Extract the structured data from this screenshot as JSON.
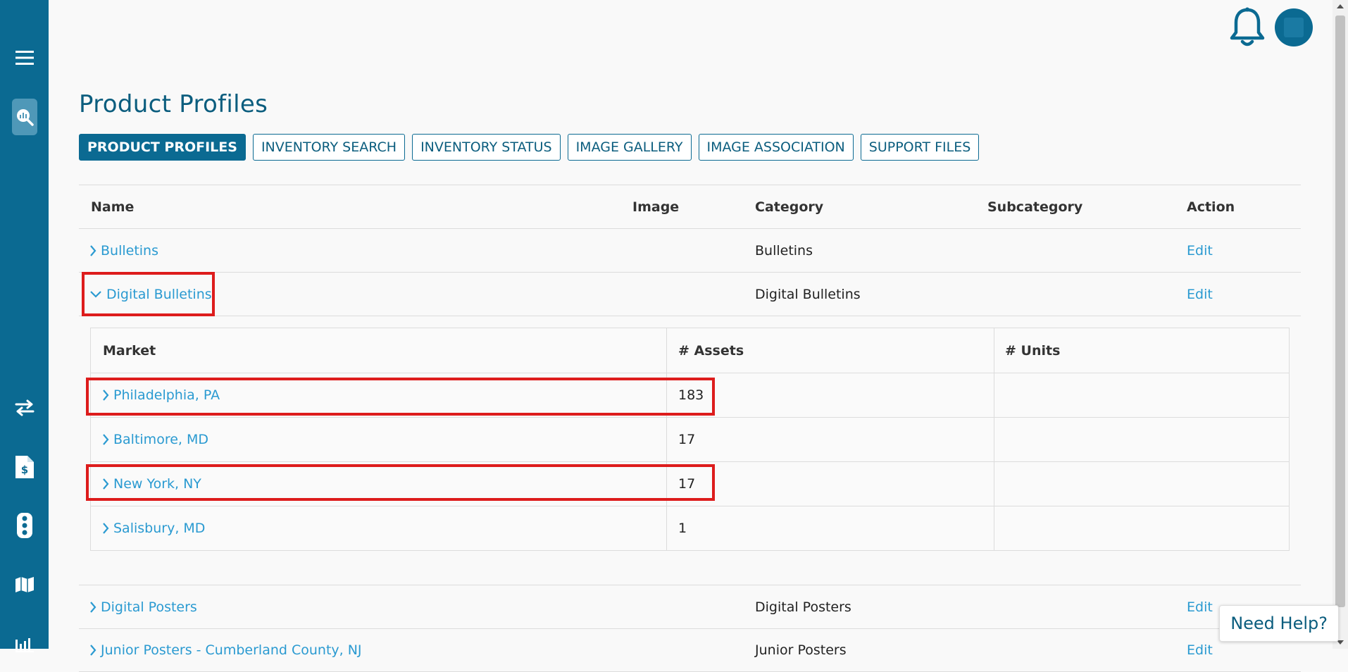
{
  "sidebar": {
    "icons": [
      "menu-icon",
      "inventory-search-icon",
      "swap-icon",
      "invoice-icon",
      "traffic-light-icon",
      "map-icon",
      "bar-chart-icon"
    ]
  },
  "header": {
    "bell_icon": "bell-icon",
    "avatar_icon": "avatar"
  },
  "page": {
    "title": "Product Profiles",
    "tabs": [
      {
        "label": "PRODUCT PROFILES",
        "active": true
      },
      {
        "label": "INVENTORY SEARCH",
        "active": false
      },
      {
        "label": "INVENTORY STATUS",
        "active": false
      },
      {
        "label": "IMAGE GALLERY",
        "active": false
      },
      {
        "label": "IMAGE ASSOCIATION",
        "active": false
      },
      {
        "label": "SUPPORT FILES",
        "active": false
      }
    ]
  },
  "table": {
    "headers": {
      "name": "Name",
      "image": "Image",
      "category": "Category",
      "subcategory": "Subcategory",
      "action": "Action"
    },
    "rows": [
      {
        "name": "Bulletins",
        "category": "Bulletins",
        "action": "Edit",
        "expanded": false
      },
      {
        "name": "Digital Bulletins",
        "category": "Digital Bulletins",
        "action": "Edit",
        "expanded": true
      },
      {
        "name": "Digital Posters",
        "category": "Digital Posters",
        "action": "Edit",
        "expanded": false
      },
      {
        "name": "Junior Posters - Cumberland County, NJ",
        "category": "Junior Posters",
        "action": "Edit",
        "expanded": false
      }
    ]
  },
  "subtable": {
    "headers": {
      "market": "Market",
      "assets": "# Assets",
      "units": "# Units"
    },
    "rows": [
      {
        "market": "Philadelphia, PA",
        "assets": "183",
        "units": ""
      },
      {
        "market": "Baltimore, MD",
        "assets": "17",
        "units": ""
      },
      {
        "market": "New York, NY",
        "assets": "17",
        "units": ""
      },
      {
        "market": "Salisbury, MD",
        "assets": "1",
        "units": ""
      }
    ]
  },
  "help": {
    "label": "Need Help?"
  },
  "colors": {
    "brand": "#0b6a92",
    "link": "#2a9ad1",
    "highlight": "#dd1c1c"
  }
}
